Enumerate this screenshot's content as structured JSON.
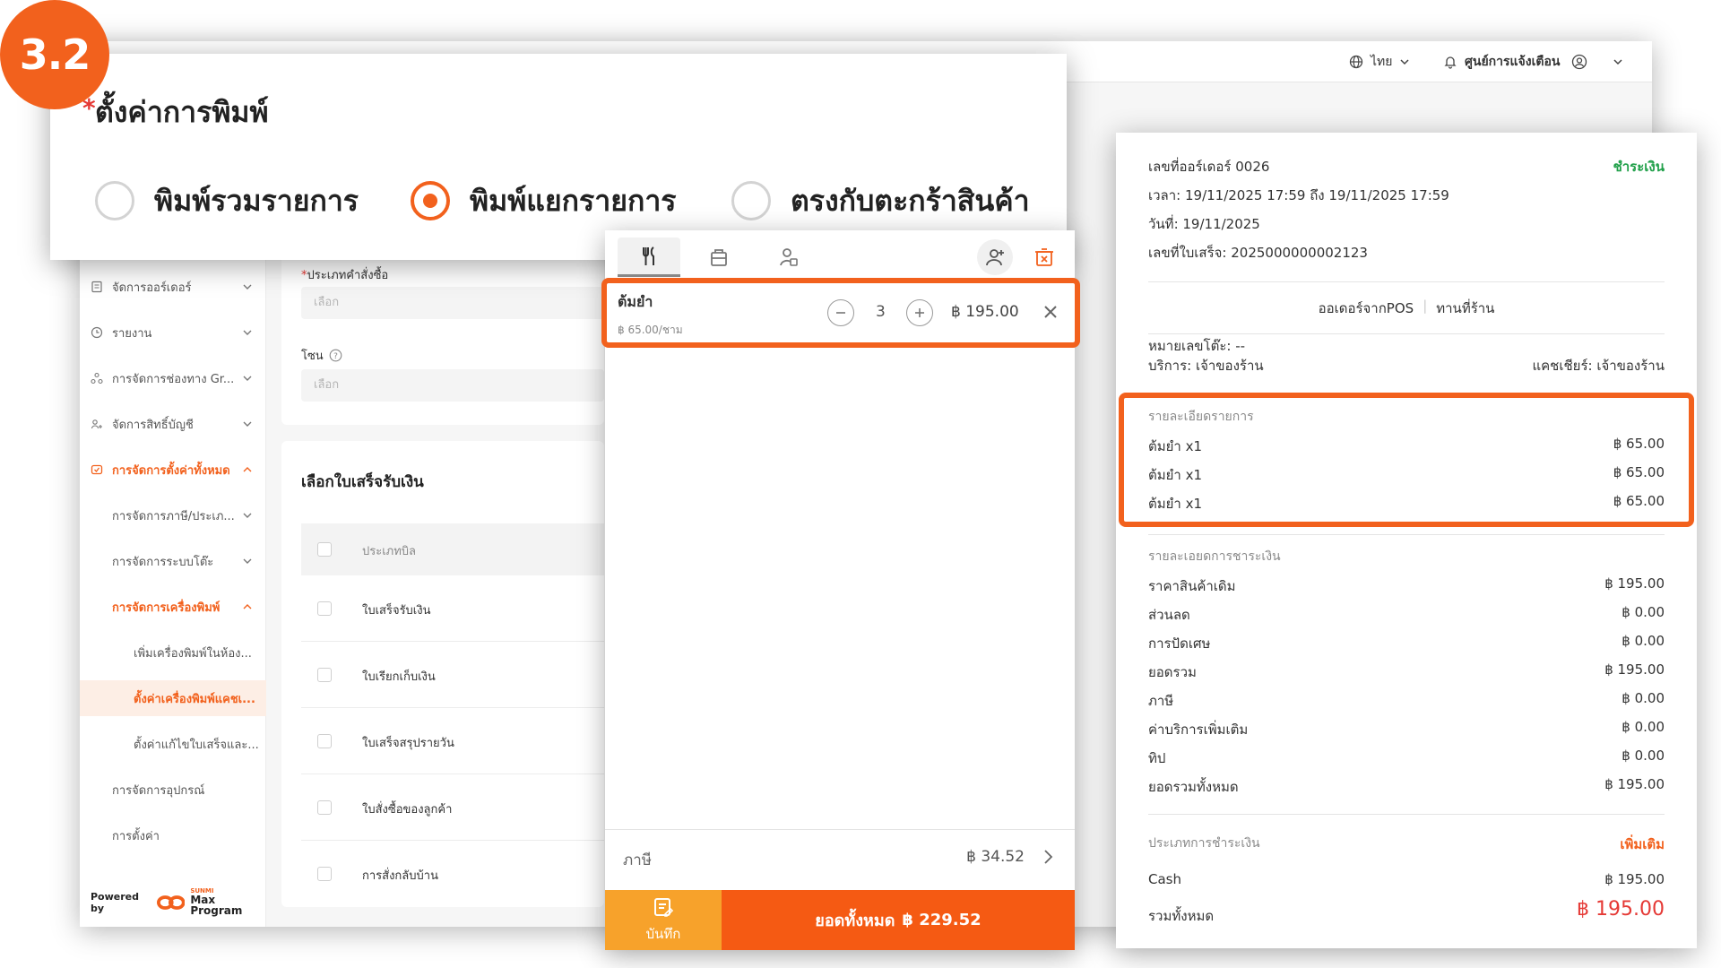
{
  "step_badge": "3.2",
  "colors": {
    "accent": "#f2611d",
    "save_button": "#f7a22b",
    "total_button": "#f55a13",
    "paid_green": "#21a04a",
    "total_red": "#e53935"
  },
  "topbar": {
    "language": "ไทย",
    "notification_center": "ศูนย์การแจ้งเตือน",
    "icons": [
      "globe-icon",
      "chevron-down-icon",
      "bell-icon",
      "user-circle-icon",
      "chevron-down-icon"
    ]
  },
  "print_settings": {
    "title": "ตั้งค่าการพิมพ์",
    "required_mark": "*",
    "options": [
      {
        "label": "พิมพ์รวมรายการ",
        "selected": false
      },
      {
        "label": "พิมพ์แยกรายการ",
        "selected": true
      },
      {
        "label": "ตรงกับตะกร้าสินค้า",
        "selected": false
      }
    ]
  },
  "sidebar": {
    "items": [
      {
        "label": "จัดการออร์เดอร์",
        "icon": "order-icon",
        "state": "collapsed"
      },
      {
        "label": "รายงาน",
        "icon": "clock-icon",
        "state": "collapsed"
      },
      {
        "label": "การจัดการช่องทาง Gr...",
        "icon": "channel-icon",
        "state": "collapsed"
      },
      {
        "label": "จัดการสิทธิ์บัญชี",
        "icon": "users-icon",
        "state": "collapsed"
      },
      {
        "label": "การจัดการตั้งค่าทั้งหมด",
        "icon": "settings-icon",
        "state": "expanded"
      },
      {
        "label": "การจัดการภาษี/ประเภ...",
        "state": "collapsed"
      },
      {
        "label": "การจัดการระบบโต๊ะ",
        "state": "collapsed"
      },
      {
        "label": "การจัดการเครื่องพิมพ์",
        "state": "expanded"
      },
      {
        "label": "เพิ่มเครื่องพิมพ์ในห้อง..."
      },
      {
        "label": "ตั้งค่าเครื่องพิมพ์แคชเ...",
        "state": "selected"
      },
      {
        "label": "ตั้งค่าแก้ไขใบเสร็จและ..."
      },
      {
        "label": "การจัดการอุปกรณ์"
      },
      {
        "label": "การตั้งค่า"
      }
    ],
    "powered_by": "Powered by",
    "brand_small": "SUNMI",
    "brand": "Max Program"
  },
  "form": {
    "order_type_label": "ประเภทคำสั่งซื้อ",
    "order_type_placeholder": "เลือก",
    "zone_label": "โซน",
    "zone_placeholder": "เลือก",
    "receipt_section_title": "เลือกใบเสร็จรับเงิน",
    "table_header": "ประเภทบิล",
    "rows": [
      "ใบเสร็จรับเงิน",
      "ใบเรียกเก็บเงิน",
      "ใบเสร็จสรุปรายวัน",
      "ใบสั่งซื้อของลูกค้า",
      "การสั่งกลับบ้าน"
    ]
  },
  "cart": {
    "tab_icons": [
      "utensils-icon",
      "takeaway-bag-icon",
      "user-list-icon",
      "add-customer-icon",
      "delete-cart-icon"
    ],
    "item": {
      "name": "ต้มยำ",
      "unit_price": "฿ 65.00/ชาม",
      "quantity": "3",
      "price": "฿ 195.00"
    },
    "tax_label": "ภาษี",
    "tax_value": "฿ 34.52",
    "save_label": "บันทึก",
    "total_label": "ยอดทั้งหมด",
    "total_value": "฿ 229.52"
  },
  "receipt": {
    "order_no": "เลขที่ออร์เดอร์ 0026",
    "status": "ชำระเงิน",
    "time": "เวลา: 19/11/2025 17:59 ถึง 19/11/2025 17:59",
    "date": "วันที่: 19/11/2025",
    "receipt_no": "เลขที่ใบเสร็จ: 2025000000002123",
    "source": "ออเดอร์จากPOS",
    "dining": "ทานที่ร้าน",
    "table_no": "หมายเลขโต๊ะ: --",
    "service": "บริการ: เจ้าของร้าน",
    "cashier": "แคชเชียร์: เจ้าของร้าน",
    "items_title": "รายละเอียดรายการ",
    "items": [
      {
        "name": "ต้มยำ x1",
        "price": "฿ 65.00"
      },
      {
        "name": "ต้มยำ x1",
        "price": "฿ 65.00"
      },
      {
        "name": "ต้มยำ x1",
        "price": "฿ 65.00"
      }
    ],
    "payment_title": "รายละเอยดการชาระเงิน",
    "payment_lines": [
      {
        "label": "ราคาสินค้าเดิม",
        "value": "฿ 195.00"
      },
      {
        "label": "ส่วนลด",
        "value": "฿ 0.00"
      },
      {
        "label": "การปัดเศษ",
        "value": "฿ 0.00"
      },
      {
        "label": "ยอดรวม",
        "value": "฿ 195.00"
      },
      {
        "label": "ภาษี",
        "value": "฿ 0.00"
      },
      {
        "label": "ค่าบริการเพิ่มเติม",
        "value": "฿ 0.00"
      },
      {
        "label": "ทิป",
        "value": "฿ 0.00"
      },
      {
        "label": "ยอดรวมทั้งหมด",
        "value": "฿ 195.00"
      }
    ],
    "payment_type_title": "ประเภทการชำระเงิน",
    "add_more": "เพิ่มเติม",
    "method": "Cash",
    "method_value": "฿ 195.00",
    "grand_label": "รวมทั้งหมด",
    "grand_value": "฿ 195.00"
  }
}
